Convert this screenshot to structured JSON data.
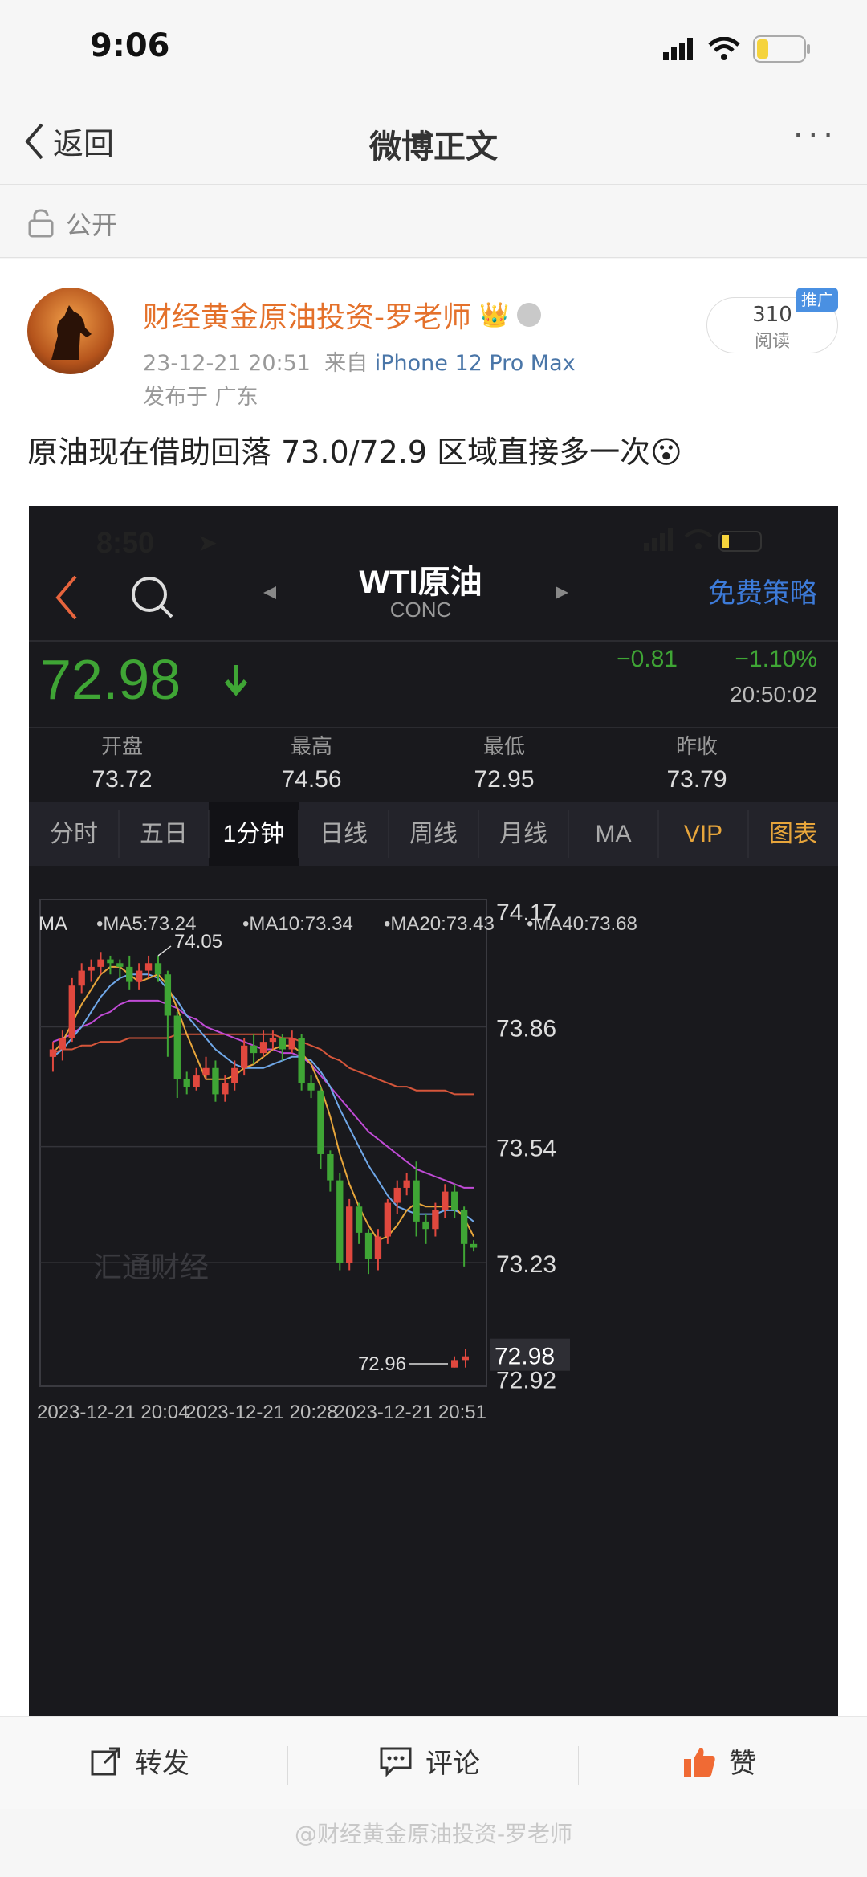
{
  "status_bar": {
    "time": "9:06"
  },
  "nav": {
    "back_label": "返回",
    "title": "微博正文",
    "more": "···"
  },
  "visibility": {
    "label": "公开"
  },
  "post": {
    "username": "财经黄金原油投资-罗老师",
    "date": "23-12-21 20:51",
    "source_prefix": "来自",
    "device": "iPhone 12 Pro Max",
    "location": "发布于 广东",
    "reads": "310",
    "reads_label": "阅读",
    "promo": "推广",
    "text": "原油现在借助回落 73.0/72.9 区域直接多一次😮"
  },
  "embedded": {
    "status_time": "8:50",
    "symbol": "WTI原油",
    "code": "CONC",
    "strategy": "免费策略",
    "price": "72.98",
    "change": "−0.81",
    "change_pct": "−1.10%",
    "quote_time": "20:50:02",
    "stats": [
      {
        "label": "开盘",
        "value": "73.72"
      },
      {
        "label": "最高",
        "value": "74.56"
      },
      {
        "label": "最低",
        "value": "72.95"
      },
      {
        "label": "昨收",
        "value": "73.79"
      }
    ],
    "tabs": [
      "分时",
      "五日",
      "1分钟",
      "日线",
      "周线",
      "月线",
      "MA",
      "VIP",
      "图表"
    ],
    "active_tab": "1分钟",
    "ma_legend": [
      "MA",
      "•MA5:73.24",
      "•MA10:73.34",
      "•MA20:73.43",
      "•MA40:73.68"
    ],
    "watermark": "汇通财经",
    "colors": {
      "up": "#e0483e",
      "down": "#3fa535",
      "ma5": "#e7a53b",
      "ma10": "#6fa7e8",
      "ma20": "#c04bd6",
      "ma40": "#d6563b"
    }
  },
  "chart_data": {
    "type": "candlestick",
    "y_ticks": [
      "74.17",
      "73.86",
      "73.54",
      "73.23",
      "72.92"
    ],
    "x_ticks": [
      "2023-12-21 20:04",
      "2023-12-21 20:28",
      "2023-12-21 20:51"
    ],
    "high_label": "74.05",
    "low_label": "72.96",
    "last_price_label": "72.98",
    "ylim": [
      72.9,
      74.2
    ],
    "candles": [
      [
        73.78,
        73.8,
        73.74,
        73.82
      ],
      [
        73.8,
        73.83,
        73.77,
        73.85
      ],
      [
        73.83,
        73.97,
        73.82,
        73.99
      ],
      [
        73.97,
        74.01,
        73.95,
        74.03
      ],
      [
        74.01,
        74.02,
        73.98,
        74.04
      ],
      [
        74.02,
        74.04,
        74.0,
        74.06
      ],
      [
        74.04,
        74.03,
        74.0,
        74.05
      ],
      [
        74.03,
        74.02,
        73.99,
        74.04
      ],
      [
        74.02,
        73.98,
        73.96,
        74.05
      ],
      [
        73.98,
        74.01,
        73.96,
        74.03
      ],
      [
        74.01,
        74.03,
        73.99,
        74.05
      ],
      [
        74.03,
        74.0,
        73.98,
        74.05
      ],
      [
        74.0,
        73.89,
        73.78,
        74.01
      ],
      [
        73.89,
        73.72,
        73.67,
        73.9
      ],
      [
        73.72,
        73.7,
        73.68,
        73.74
      ],
      [
        73.7,
        73.73,
        73.69,
        73.75
      ],
      [
        73.73,
        73.75,
        73.72,
        73.78
      ],
      [
        73.75,
        73.68,
        73.66,
        73.77
      ],
      [
        73.68,
        73.71,
        73.66,
        73.73
      ],
      [
        73.71,
        73.75,
        73.69,
        73.77
      ],
      [
        73.75,
        73.81,
        73.73,
        73.83
      ],
      [
        73.81,
        73.79,
        73.76,
        73.84
      ],
      [
        73.79,
        73.82,
        73.78,
        73.85
      ],
      [
        73.82,
        73.83,
        73.8,
        73.85
      ],
      [
        73.83,
        73.8,
        73.77,
        73.84
      ],
      [
        73.8,
        73.83,
        73.79,
        73.85
      ],
      [
        73.83,
        73.71,
        73.69,
        73.84
      ],
      [
        73.71,
        73.69,
        73.67,
        73.73
      ],
      [
        73.69,
        73.52,
        73.48,
        73.7
      ],
      [
        73.52,
        73.45,
        73.42,
        73.53
      ],
      [
        73.45,
        73.23,
        73.21,
        73.47
      ],
      [
        73.23,
        73.38,
        73.21,
        73.4
      ],
      [
        73.38,
        73.31,
        73.28,
        73.39
      ],
      [
        73.31,
        73.24,
        73.2,
        73.32
      ],
      [
        73.24,
        73.3,
        73.21,
        73.32
      ],
      [
        73.3,
        73.39,
        73.28,
        73.4
      ],
      [
        73.39,
        73.43,
        73.36,
        73.45
      ],
      [
        73.43,
        73.45,
        73.41,
        73.47
      ],
      [
        73.45,
        73.34,
        73.3,
        73.5
      ],
      [
        73.34,
        73.32,
        73.28,
        73.36
      ],
      [
        73.32,
        73.37,
        73.3,
        73.39
      ],
      [
        73.37,
        73.42,
        73.35,
        73.44
      ],
      [
        73.42,
        73.37,
        73.35,
        73.44
      ],
      [
        73.37,
        73.28,
        73.22,
        73.38
      ],
      [
        73.28,
        73.27,
        73.26,
        73.29
      ]
    ],
    "ma5": [
      73.79,
      73.82,
      73.87,
      73.92,
      73.96,
      74.0,
      74.02,
      74.02,
      74.0,
      73.98,
      73.99,
      74.0,
      73.97,
      73.91,
      73.84,
      73.78,
      73.72,
      73.72,
      73.72,
      73.73,
      73.75,
      73.76,
      73.78,
      73.8,
      73.81,
      73.81,
      73.79,
      73.76,
      73.7,
      73.62,
      73.52,
      73.44,
      73.38,
      73.33,
      73.29,
      73.3,
      73.33,
      73.37,
      73.39,
      73.38,
      73.38,
      73.38,
      73.38,
      73.35,
      73.3
    ],
    "ma10": [
      73.78,
      73.8,
      73.83,
      73.86,
      73.9,
      73.94,
      73.97,
      73.99,
      74.0,
      74.0,
      74.0,
      73.99,
      73.96,
      73.93,
      73.89,
      73.86,
      73.83,
      73.8,
      73.78,
      73.76,
      73.75,
      73.75,
      73.75,
      73.76,
      73.77,
      73.78,
      73.78,
      73.77,
      73.74,
      73.7,
      73.64,
      73.59,
      73.54,
      73.49,
      73.45,
      73.41,
      73.38,
      73.37,
      73.36,
      73.36,
      73.36,
      73.37,
      73.37,
      73.36,
      73.34
    ],
    "ma20": [
      73.82,
      73.83,
      73.84,
      73.86,
      73.87,
      73.89,
      73.9,
      73.92,
      73.93,
      73.93,
      73.93,
      73.93,
      73.92,
      73.91,
      73.89,
      73.88,
      73.86,
      73.85,
      73.84,
      73.83,
      73.82,
      73.81,
      73.8,
      73.8,
      73.79,
      73.79,
      73.78,
      73.76,
      73.73,
      73.7,
      73.67,
      73.64,
      73.61,
      73.58,
      73.56,
      73.54,
      73.52,
      73.5,
      73.48,
      73.47,
      73.46,
      73.45,
      73.44,
      73.43,
      73.43
    ],
    "ma40": [
      73.79,
      73.8,
      73.8,
      73.81,
      73.81,
      73.82,
      73.82,
      73.82,
      73.83,
      73.83,
      73.83,
      73.83,
      73.83,
      73.84,
      73.84,
      73.84,
      73.84,
      73.84,
      73.84,
      73.84,
      73.84,
      73.84,
      73.84,
      73.84,
      73.83,
      73.83,
      73.82,
      73.81,
      73.8,
      73.78,
      73.77,
      73.75,
      73.74,
      73.73,
      73.72,
      73.71,
      73.7,
      73.7,
      73.69,
      73.69,
      73.69,
      73.69,
      73.68,
      73.68,
      73.68
    ],
    "last_candles": [
      [
        72.95,
        72.97,
        72.95,
        72.98
      ],
      [
        72.97,
        72.98,
        72.95,
        73.0
      ]
    ]
  },
  "actions": {
    "repost": "转发",
    "comment": "评论",
    "like": "赞"
  },
  "watermark": "@财经黄金原油投资-罗老师"
}
